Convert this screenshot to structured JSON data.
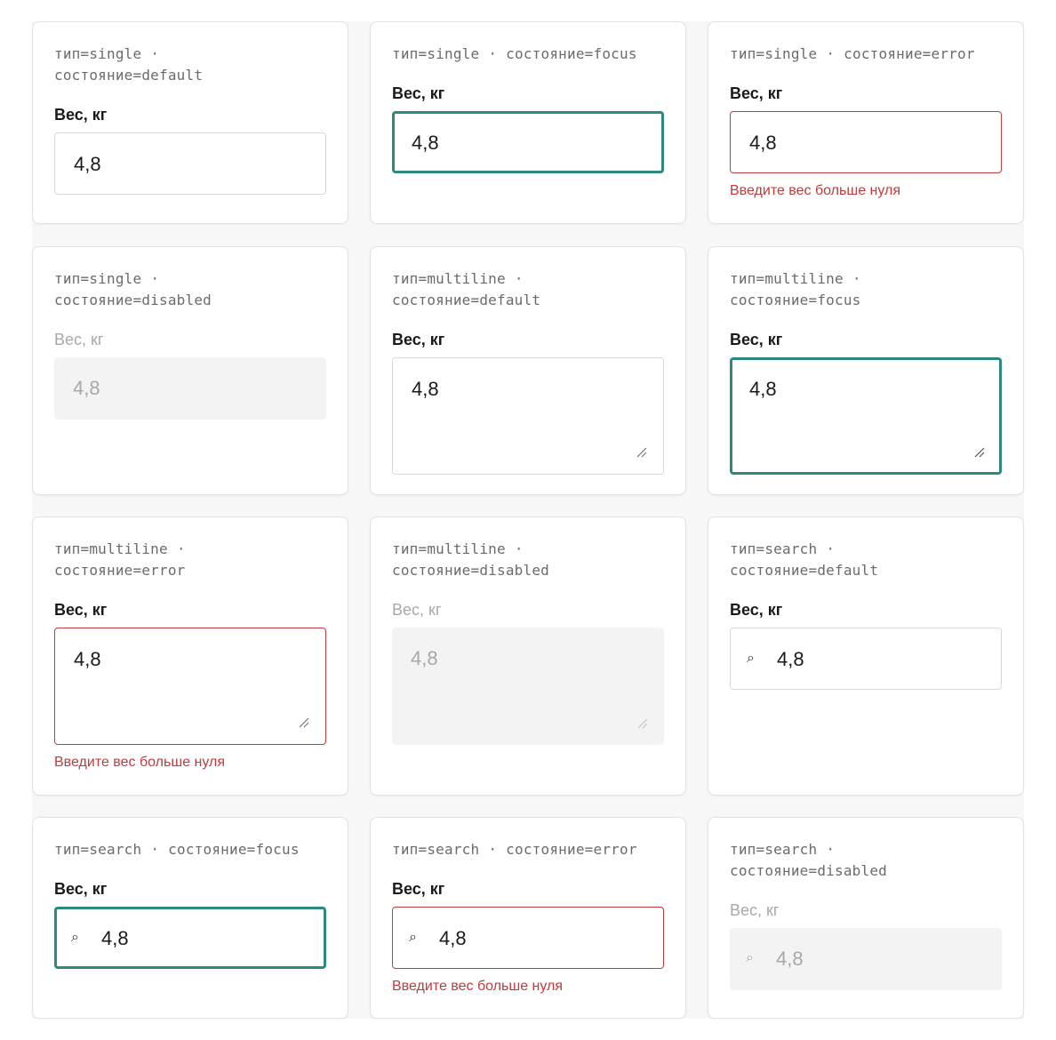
{
  "colors": {
    "focus": "#2b8a7d",
    "error": "#c23a3a",
    "disabled_bg": "#f3f3f3",
    "border": "#d8d8d8"
  },
  "label": "Вес, кг",
  "value": "4,8",
  "error_text": "Введите вес больше нуля",
  "search_icon": "search-icon",
  "cards": [
    {
      "type": "тип=single",
      "state": "состояние=default"
    },
    {
      "type": "тип=single",
      "state": "состояние=focus"
    },
    {
      "type": "тип=single",
      "state": "состояние=error"
    },
    {
      "type": "тип=single",
      "state": "состояние=disabled"
    },
    {
      "type": "тип=multiline",
      "state": "состояние=default"
    },
    {
      "type": "тип=multiline",
      "state": "состояние=focus"
    },
    {
      "type": "тип=multiline",
      "state": "состояние=error"
    },
    {
      "type": "тип=multiline",
      "state": "состояние=disabled"
    },
    {
      "type": "тип=search",
      "state": "состояние=default"
    },
    {
      "type": "тип=search",
      "state": "состояние=focus"
    },
    {
      "type": "тип=search",
      "state": "состояние=error"
    },
    {
      "type": "тип=search",
      "state": "состояние=disabled"
    }
  ]
}
